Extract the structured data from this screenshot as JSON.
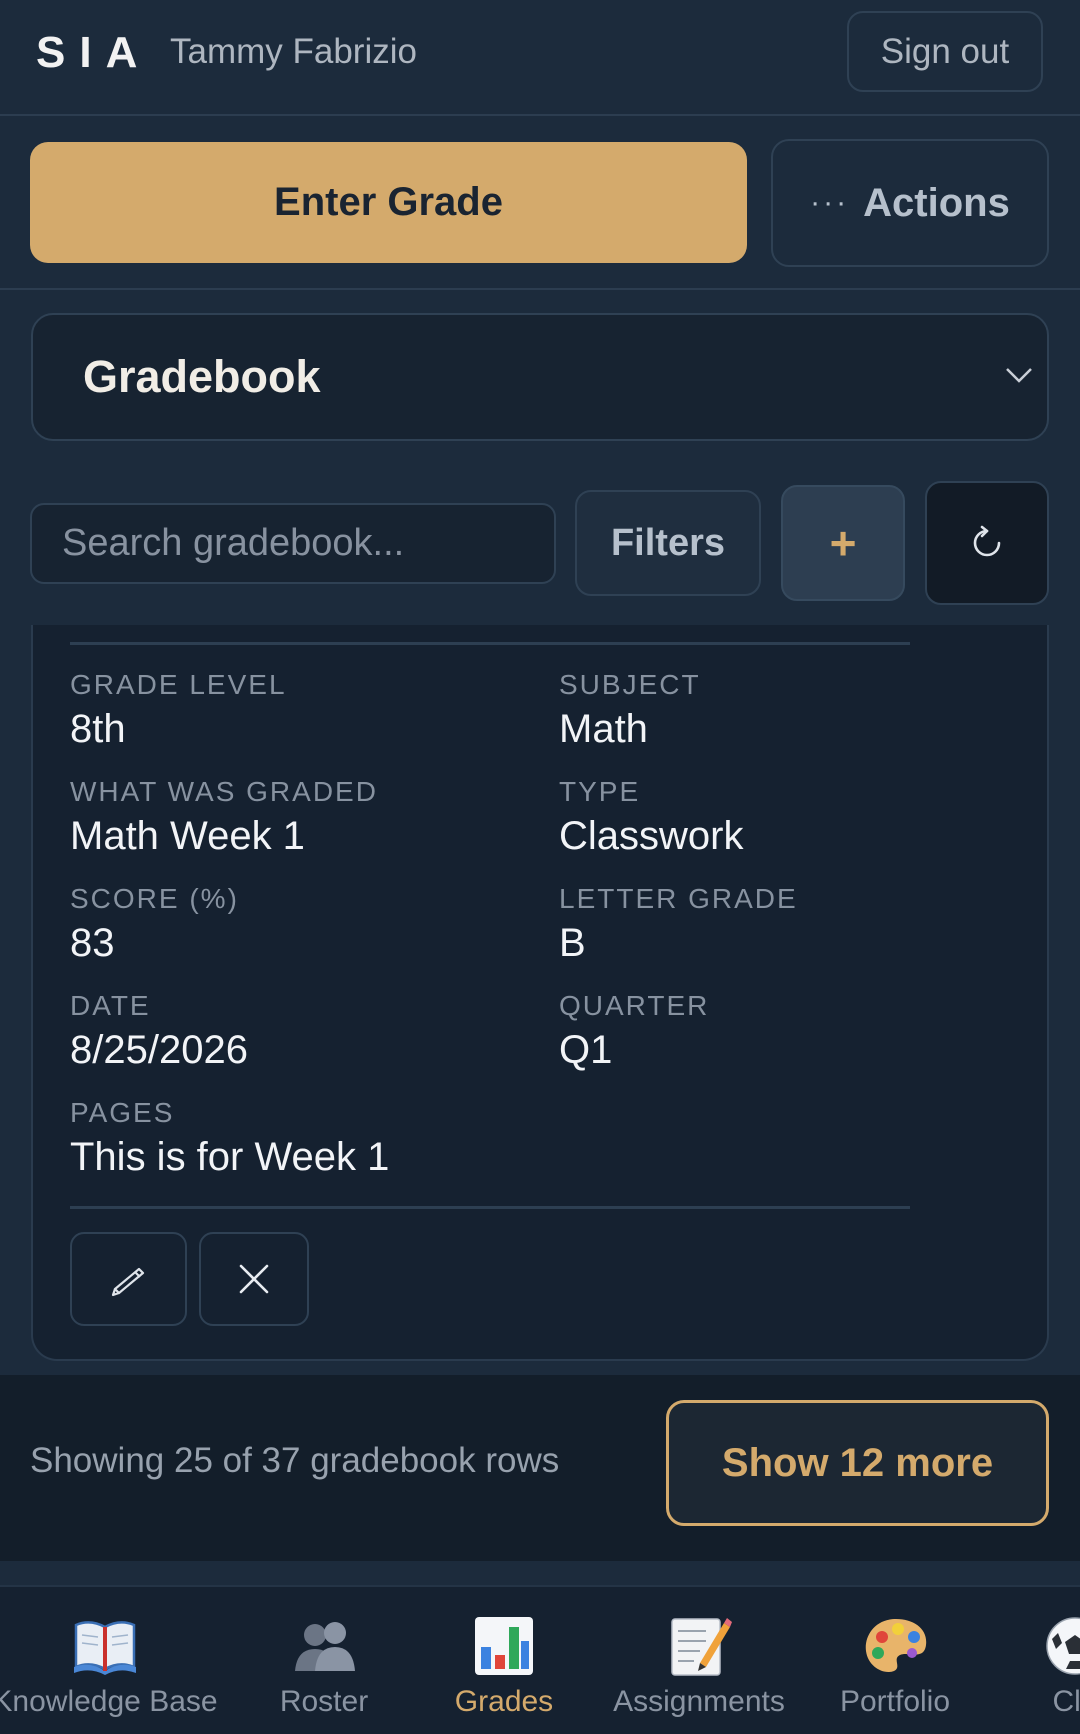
{
  "header": {
    "logo": "SIA",
    "user_name": "Tammy Fabrizio",
    "signout_label": "Sign out"
  },
  "action_bar": {
    "enter_grade_label": "Enter Grade",
    "actions_label": "Actions",
    "actions_dots": "···"
  },
  "view_selector": {
    "selected": "Gradebook"
  },
  "toolbar": {
    "search_placeholder": "Search gradebook...",
    "filters_label": "Filters",
    "add_label": "+"
  },
  "record": {
    "fields": [
      {
        "label": "GRADE LEVEL",
        "value": "8th"
      },
      {
        "label": "SUBJECT",
        "value": "Math"
      },
      {
        "label": "WHAT WAS GRADED",
        "value": "Math Week 1"
      },
      {
        "label": "TYPE",
        "value": "Classwork"
      },
      {
        "label": "SCORE (%)",
        "value": "83"
      },
      {
        "label": "LETTER GRADE",
        "value": "B"
      },
      {
        "label": "DATE",
        "value": "8/25/2026"
      },
      {
        "label": "QUARTER",
        "value": "Q1"
      },
      {
        "label": "PAGES",
        "value": "This is for Week 1"
      }
    ],
    "edit_icon": "pencil-icon",
    "delete_icon": "close-icon"
  },
  "pagination": {
    "showing_text": "Showing 25 of 37 gradebook rows",
    "show_more_label": "Show 12 more"
  },
  "bottom_nav": {
    "items": [
      {
        "label": "Knowledge Base",
        "icon": "book-icon"
      },
      {
        "label": "Roster",
        "icon": "people-icon"
      },
      {
        "label": "Grades",
        "icon": "bar-chart-icon",
        "active": true
      },
      {
        "label": "Assignments",
        "icon": "memo-icon"
      },
      {
        "label": "Portfolio",
        "icon": "palette-icon"
      },
      {
        "label": "Clu",
        "icon": "soccer-ball-icon"
      }
    ]
  },
  "colors": {
    "background": "#1c2b3c",
    "card": "#152130",
    "accent": "#d4aa6c"
  }
}
